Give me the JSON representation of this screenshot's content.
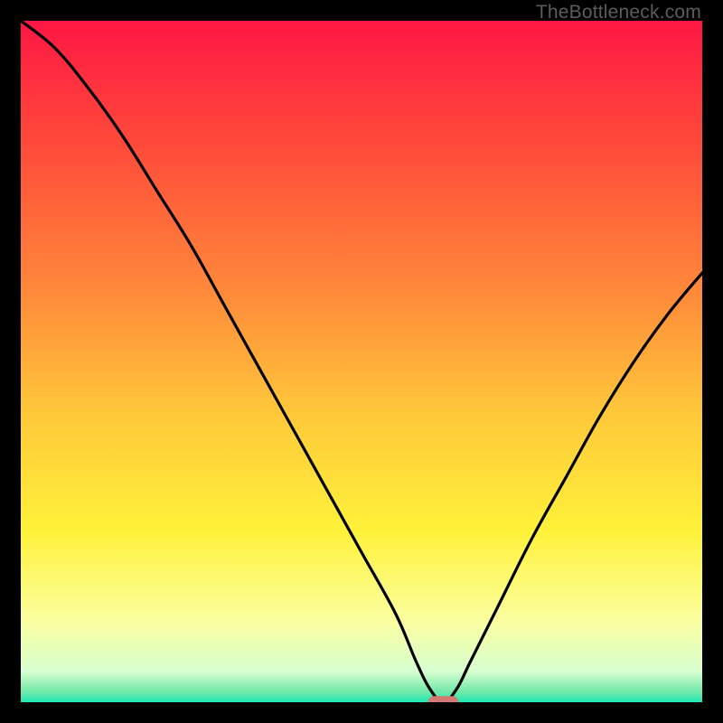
{
  "watermark": "TheBottleneck.com",
  "chart_data": {
    "type": "line",
    "title": "",
    "xlabel": "",
    "ylabel": "",
    "xlim": [
      0,
      100
    ],
    "ylim": [
      0,
      100
    ],
    "optimum_x": 62,
    "series": [
      {
        "name": "bottleneck-curve",
        "x": [
          0,
          5,
          10,
          15,
          20,
          25,
          30,
          35,
          40,
          45,
          50,
          55,
          58,
          60,
          62,
          64,
          66,
          70,
          75,
          80,
          85,
          90,
          95,
          100
        ],
        "values": [
          100,
          96,
          90,
          83,
          75,
          67,
          58,
          49,
          40,
          31,
          22,
          13,
          6,
          2,
          0,
          2,
          6,
          14,
          24,
          33,
          42,
          50,
          57,
          63
        ]
      }
    ],
    "gradient_stops": [
      {
        "offset": 0.0,
        "color": "#ff1744"
      },
      {
        "offset": 0.18,
        "color": "#ff4a3a"
      },
      {
        "offset": 0.4,
        "color": "#ff8a3a"
      },
      {
        "offset": 0.58,
        "color": "#ffc93a"
      },
      {
        "offset": 0.75,
        "color": "#fff23a"
      },
      {
        "offset": 0.88,
        "color": "#fbffa0"
      },
      {
        "offset": 0.955,
        "color": "#d7ffd0"
      },
      {
        "offset": 0.985,
        "color": "#6fe8a8"
      },
      {
        "offset": 1.0,
        "color": "#1de9b6"
      }
    ],
    "marker": {
      "x": 62,
      "y": 0,
      "color": "#d47a74",
      "width_frac": 0.045,
      "height_frac": 0.018
    }
  }
}
